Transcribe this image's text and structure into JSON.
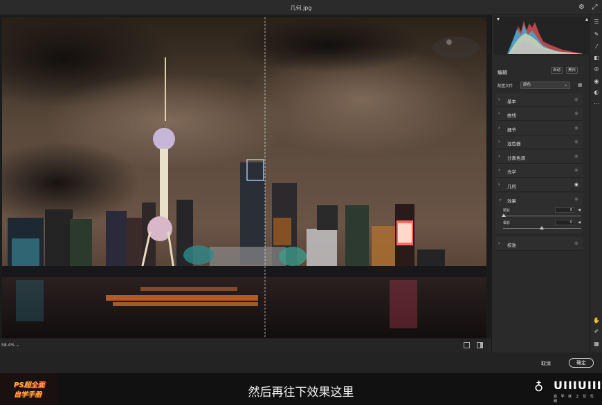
{
  "window": {
    "title": "几何.jpg"
  },
  "canvas": {
    "zoom": "58.4%"
  },
  "panel": {
    "heading": "编辑",
    "auto_label": "自动",
    "bw_label": "黑白",
    "profile_label": "配置文件",
    "profile_value": "颜色",
    "sections": [
      {
        "label": "基本",
        "eye_active": false
      },
      {
        "label": "曲线",
        "eye_active": false
      },
      {
        "label": "细节",
        "eye_active": false
      },
      {
        "label": "混色器",
        "eye_active": false
      },
      {
        "label": "分离色调",
        "eye_active": false
      },
      {
        "label": "光学",
        "eye_active": false
      },
      {
        "label": "几何",
        "eye_active": true
      }
    ],
    "effects": {
      "label": "效果",
      "sliders": [
        {
          "label": "颗粒",
          "value": "0"
        },
        {
          "label": "晕影",
          "value": "0"
        }
      ]
    },
    "calibration": {
      "label": "校准"
    }
  },
  "footer": {
    "cancel_label": "取消",
    "ok_label": "确定"
  },
  "overlay": {
    "subtitle": "然后再往下效果这里",
    "badge_line1": "PS超全面",
    "badge_line2": "自学手册",
    "logo_text": "UIIIUIII",
    "logo_sub": "自 学 就 上 优 优 网"
  },
  "colors": {
    "accent": "#ffffff",
    "panel_bg": "#2a2a2a",
    "canvas_bg": "#1b1b1b"
  }
}
